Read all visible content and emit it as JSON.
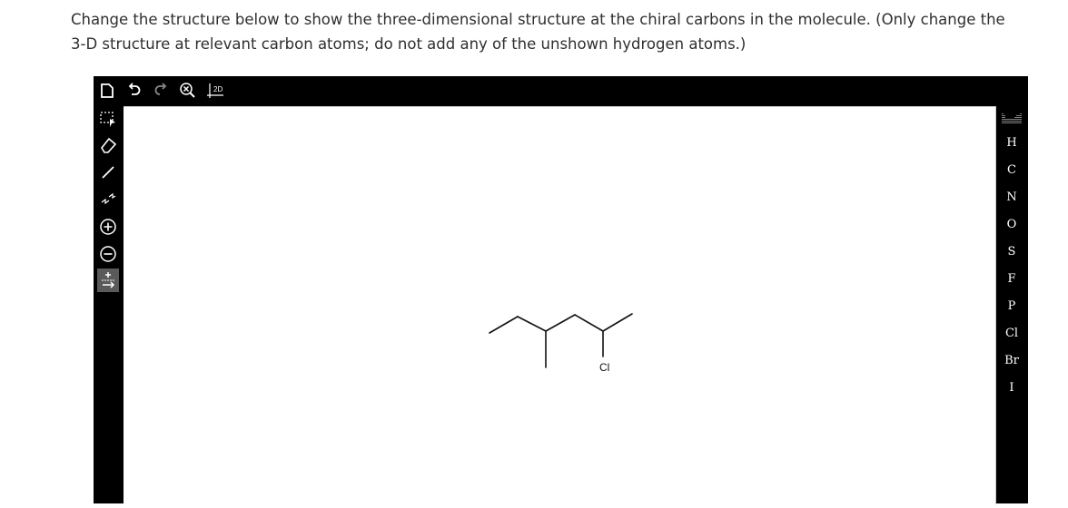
{
  "question": {
    "text": "Change the structure below to show the three-dimensional structure at the chiral carbons in the molecule. (Only change the 3-D structure at relevant carbon atoms; do not add any of the unshown hydrogen atoms.)"
  },
  "toolbar_top": {
    "items": [
      {
        "name": "new-document-icon"
      },
      {
        "name": "undo-icon"
      },
      {
        "name": "redo-icon"
      },
      {
        "name": "clear-zoom-icon"
      },
      {
        "name": "clean-2d-icon",
        "label": "2D"
      }
    ]
  },
  "toolbar_left": {
    "items": [
      {
        "name": "select-lasso-icon"
      },
      {
        "name": "eraser-icon"
      },
      {
        "name": "single-bond-icon"
      },
      {
        "name": "chain-icon"
      },
      {
        "name": "positive-charge-icon"
      },
      {
        "name": "negative-charge-icon"
      },
      {
        "name": "add-lone-pair-icon"
      }
    ]
  },
  "periodic_table": {
    "label": "periodic-table-icon"
  },
  "atoms": [
    "H",
    "C",
    "N",
    "O",
    "S",
    "F",
    "P",
    "Cl",
    "Br",
    "I"
  ],
  "molecule": {
    "substituent_label": "Cl"
  },
  "colors": {
    "toolbar_bg": "#000000",
    "canvas_bg": "#ffffff",
    "text": "#2f2f2f"
  }
}
